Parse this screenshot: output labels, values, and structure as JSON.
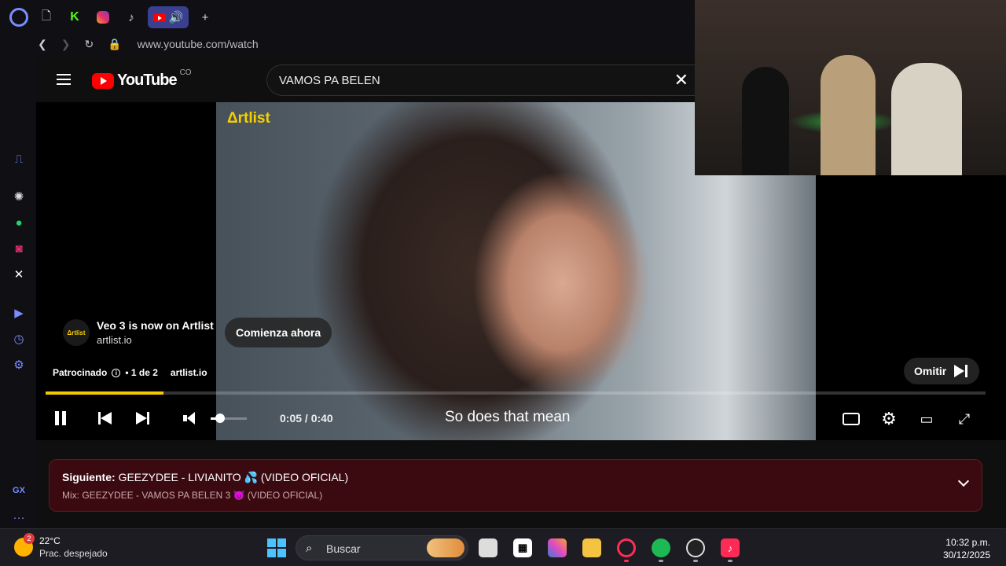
{
  "browser": {
    "tabs": [
      {
        "icon": "document-icon"
      },
      {
        "icon": "kick-icon",
        "glyph": "K"
      },
      {
        "icon": "instagram-icon"
      },
      {
        "icon": "tiktok-icon",
        "glyph": "♪"
      },
      {
        "icon": "youtube-audio-tab-icon",
        "active": true
      }
    ],
    "new_tab_glyph": "+",
    "url": "www.youtube.com/watch"
  },
  "sidebar": {
    "items": [
      "game-controller-icon",
      "chatgpt-icon",
      "whatsapp-icon",
      "instagram-icon",
      "x-icon",
      "player-icon",
      "history-icon",
      "settings-icon"
    ],
    "gx_label": "GX",
    "more_glyph": "···"
  },
  "youtube": {
    "logo_word": "YouTube",
    "country": "CO",
    "search_query": "VAMOS PA BELEN"
  },
  "ad": {
    "watermark": "Δrtlist",
    "logo_text": "Δrtlist",
    "title": "Veo 3 is now on Artlist",
    "domain": "artlist.io",
    "cta": "Comienza ahora",
    "sponsored": "Patrocinado",
    "position": "• 1 de 2",
    "meta_domain": "artlist.io",
    "skip_label": "Omitir"
  },
  "player": {
    "time": "0:05 / 0:40",
    "caption": "So does that mean",
    "progress_fraction": 0.125,
    "volume_fraction": 0.25
  },
  "up_next": {
    "label": "Siguiente:",
    "title": "GEEZYDEE - LIVIANITO 💦 (VIDEO OFICIAL)",
    "mix": "Mix: GEEZYDEE - VAMOS PA BELEN 3 👿 (VIDEO OFICIAL)"
  },
  "taskbar": {
    "weather_badge": "2",
    "temperature": "22°C",
    "condition": "Prac. despejado",
    "search_placeholder": "Buscar",
    "time": "10:32 p.m.",
    "date": "30/12/2025",
    "apps": [
      "start-icon",
      "task-view-icon",
      "store-icon",
      "m365-icon",
      "file-explorer-icon",
      "opera-gx-icon",
      "spotify-icon",
      "obs-icon",
      "tiktok-icon"
    ]
  },
  "colors": {
    "accent": "#7b8cff",
    "progress": "#f5c800",
    "up_next_bg": "#3a0a10",
    "youtube_red": "#ff0000"
  }
}
